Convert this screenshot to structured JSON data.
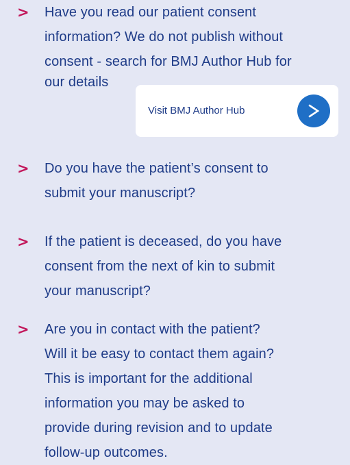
{
  "items": [
    {
      "marker": ">",
      "lines": [
        "Have you read our patient consent",
        "information? We do not publish without",
        "consent - search for BMJ Author Hub for",
        "our details"
      ]
    },
    {
      "marker": ">",
      "lines": [
        "Do you have the patient’s consent to",
        "submit your manuscript?"
      ]
    },
    {
      "marker": ">",
      "lines": [
        "If the patient is deceased, do you have",
        "consent from the next of kin to submit",
        "your manuscript?"
      ]
    },
    {
      "marker": ">",
      "lines": [
        "Are you in contact with the patient?",
        "Will it be easy to contact them again?",
        "This is important for the additional",
        "information you may be asked to",
        "provide during revision and to update",
        "follow-up outcomes."
      ]
    }
  ],
  "hub": {
    "label": "Visit BMJ Author Hub"
  },
  "icons": {
    "bullet": "chevron-right-icon",
    "hub_button": "chevron-right-icon"
  },
  "colors": {
    "background": "#e4e7f4",
    "text": "#1f3c88",
    "bullet": "#c2185b",
    "button": "#1f6fc6",
    "card": "#ffffff"
  }
}
